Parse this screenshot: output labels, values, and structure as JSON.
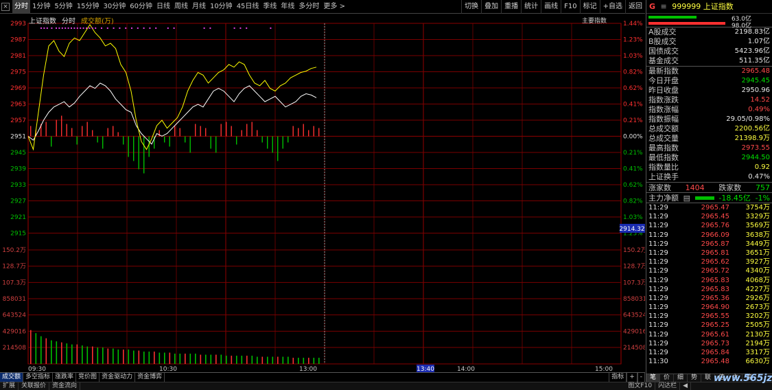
{
  "toolbar": {
    "close_label": "×",
    "periods": [
      "分时",
      "1分钟",
      "5分钟",
      "15分钟",
      "30分钟",
      "60分钟",
      "日线",
      "周线",
      "月线",
      "10分钟",
      "45日线",
      "季线",
      "年线",
      "多分时",
      "更多 >"
    ],
    "active_period": 0,
    "tools": [
      "切换",
      "叠加",
      "重播",
      "统计",
      "画线",
      "F10",
      "标记",
      "+自选",
      "返回"
    ]
  },
  "chart_header": {
    "title": "上证指数",
    "mode": "分时",
    "volume_label": "成交额(万)",
    "indicator_button": "主要指数"
  },
  "price_axis": {
    "left_labels": [
      "2993",
      "2987",
      "2981",
      "2975",
      "2969",
      "2963",
      "2957",
      "2951",
      "2945",
      "2939",
      "2933",
      "2927",
      "2921",
      "2915"
    ],
    "right_labels": [
      "1.44%",
      "1.23%",
      "1.03%",
      "0.82%",
      "0.62%",
      "0.41%",
      "0.21%",
      "0.00%",
      "0.21%",
      "0.41%",
      "0.62%",
      "0.82%",
      "1.03%",
      "1.23%"
    ],
    "prev_close_index": 7,
    "cursor_value": "2914.32"
  },
  "volume_axis": {
    "labels": [
      "150.2万",
      "128.7万",
      "107.3万",
      "858031",
      "643524",
      "429016",
      "214508"
    ]
  },
  "time_axis": {
    "labels": [
      "09:30",
      "10:30",
      "13:00",
      "13:40",
      "14:00",
      "15:00"
    ],
    "cursor_time": "13:40"
  },
  "bottom_tabs": {
    "tabs": [
      "成交额",
      "多空指标",
      "涨跌率",
      "竞价图",
      "资金驱动力",
      "资金博弈"
    ],
    "active": 0,
    "right": [
      "指标",
      "+",
      "-"
    ]
  },
  "status_bar": {
    "left": [
      "扩展",
      "关联报价",
      "资金流向"
    ],
    "right": [
      "图文F10",
      "闪达栏",
      "◀"
    ]
  },
  "colors": {
    "index_line": "#ffffff",
    "avg_line": "#ffff00",
    "grid": "#7a0000",
    "up": "#ff3030",
    "down": "#00c000"
  },
  "chart_data": {
    "type": "line",
    "prev_close": 2950.96,
    "ylim": [
      2912.5,
      2993.5
    ],
    "series": [
      {
        "values": [
          2950.96,
          2949.5,
          2953,
          2957,
          2960,
          2962,
          2963,
          2964,
          2962,
          2963.5,
          2966,
          2968,
          2970,
          2969,
          2971,
          2970,
          2968,
          2965,
          2963,
          2961,
          2960,
          2955,
          2952,
          2950,
          2948,
          2952,
          2951,
          2952,
          2954,
          2956,
          2958,
          2960,
          2962,
          2963,
          2962,
          2965,
          2968,
          2969,
          2968,
          2966,
          2964,
          2967,
          2969,
          2970,
          2968,
          2966,
          2964,
          2965,
          2966,
          2964,
          2962,
          2963,
          2964,
          2966,
          2967,
          2966.5,
          2965.5
        ]
      },
      {
        "values": [
          2950.96,
          2946,
          2960,
          2974,
          2985,
          2987,
          2983,
          2981,
          2986,
          2988,
          2987,
          2990,
          2993,
          2990,
          2988,
          2985,
          2986,
          2984,
          2978,
          2975,
          2968,
          2957,
          2949,
          2946,
          2950,
          2955,
          2957,
          2954,
          2956,
          2958,
          2962,
          2968,
          2972,
          2975,
          2974,
          2971,
          2973,
          2975,
          2976,
          2978,
          2977,
          2979,
          2978,
          2974,
          2971,
          2970,
          2972,
          2969,
          2968,
          2970,
          2971,
          2973,
          2974,
          2975,
          2975.5,
          2976.5,
          2977
        ]
      }
    ],
    "volume_bars": [
      0.33,
      0.3,
      0.27,
      0.25,
      0.23,
      0.22,
      0.21,
      0.2,
      0.19,
      0.19,
      0.18,
      0.17,
      0.17,
      0.16,
      0.16,
      0.15,
      0.15,
      0.14,
      0.14,
      0.14,
      0.13,
      0.13,
      0.12,
      0.12,
      0.12,
      0.11,
      0.11,
      0.11,
      0.1,
      0.1,
      0.1,
      0.1,
      0.1,
      0.09,
      0.09,
      0.09,
      0.09,
      0.09,
      0.08,
      0.08,
      0.08,
      0.08,
      0.08,
      0.08,
      0.07,
      0.07,
      0.07,
      0.07,
      0.07,
      0.07,
      0.07,
      0.06,
      0.06,
      0.06,
      0.06,
      0.06,
      0.06
    ],
    "breadth_bars": [
      0.5,
      0.3,
      0.6,
      0.7,
      -0.5,
      0.8,
      1.0,
      0.6,
      0.4,
      -0.4,
      0.5,
      0.7,
      0.3,
      -0.3,
      -0.6,
      0.4,
      0.5,
      0.2,
      -0.4,
      -1.0,
      -1.2,
      -1.6,
      -1.8,
      -1.0,
      -0.6,
      0.3,
      -0.3,
      -0.5,
      0.5,
      0.4,
      -0.3,
      -0.8,
      0.6,
      0.5,
      0.4,
      -0.6,
      -0.8,
      0.6,
      0.7,
      0.5,
      -0.4,
      0.3,
      0.6,
      0.7,
      0.3,
      -0.3,
      -0.6,
      -0.8,
      -1.2,
      -0.6,
      -0.3,
      0.5,
      0.4,
      0.6,
      0.3,
      0.5,
      0.4
    ]
  },
  "right_panel": {
    "title_letter": "G",
    "menu_icon": "≡",
    "code": "999999",
    "name": "上证指数",
    "bar_top_value": "63.0亿",
    "bar_bottom_value": "98.0亿",
    "stats1": [
      {
        "label": "A股成交",
        "value": "2198.83亿",
        "color": "white"
      },
      {
        "label": "B股成交",
        "value": "1.07亿",
        "color": "white"
      },
      {
        "label": "国债成交",
        "value": "5423.96亿",
        "color": "white"
      },
      {
        "label": "基金成交",
        "value": "511.35亿",
        "color": "white"
      }
    ],
    "stats2": [
      {
        "label": "最新指数",
        "value": "2965.48",
        "color": "red"
      },
      {
        "label": "今日开盘",
        "value": "2945.45",
        "color": "green"
      },
      {
        "label": "昨日收盘",
        "value": "2950.96",
        "color": "white"
      },
      {
        "label": "指数涨跌",
        "value": "14.52",
        "color": "red"
      },
      {
        "label": "指数涨幅",
        "value": "0.49%",
        "color": "red"
      },
      {
        "label": "指数振幅",
        "value": "29.05/0.98%",
        "color": "white"
      },
      {
        "label": "总成交额",
        "value": "2200.56亿",
        "color": "yellow"
      },
      {
        "label": "总成交量",
        "value": "21398.9万",
        "color": "yellow"
      },
      {
        "label": "最高指数",
        "value": "2973.55",
        "color": "red"
      },
      {
        "label": "最低指数",
        "value": "2944.50",
        "color": "green"
      },
      {
        "label": "指数量比",
        "value": "0.92",
        "color": "yellow"
      },
      {
        "label": "上证换手",
        "value": "0.47%",
        "color": "white"
      }
    ],
    "breadth": {
      "up_label": "涨家数",
      "up": "1404",
      "down_label": "跌家数",
      "down": "757"
    },
    "main_flow": {
      "label": "主力净额",
      "icon": "▤",
      "value": "-18.45亿",
      "pct": "-1%"
    },
    "ticks": [
      {
        "t": "11:29",
        "p": "2965.47",
        "v": "3754万"
      },
      {
        "t": "11:29",
        "p": "2965.45",
        "v": "3329万"
      },
      {
        "t": "11:29",
        "p": "2965.76",
        "v": "3569万"
      },
      {
        "t": "11:29",
        "p": "2966.09",
        "v": "3638万"
      },
      {
        "t": "11:29",
        "p": "2965.87",
        "v": "3449万"
      },
      {
        "t": "11:29",
        "p": "2965.81",
        "v": "3651万"
      },
      {
        "t": "11:29",
        "p": "2965.62",
        "v": "3927万"
      },
      {
        "t": "11:29",
        "p": "2965.72",
        "v": "4340万"
      },
      {
        "t": "11:29",
        "p": "2965.83",
        "v": "4068万"
      },
      {
        "t": "11:29",
        "p": "2965.83",
        "v": "4227万"
      },
      {
        "t": "11:29",
        "p": "2965.36",
        "v": "2926万"
      },
      {
        "t": "11:29",
        "p": "2964.90",
        "v": "2673万"
      },
      {
        "t": "11:29",
        "p": "2965.55",
        "v": "3202万"
      },
      {
        "t": "11:29",
        "p": "2965.25",
        "v": "2505万"
      },
      {
        "t": "11:29",
        "p": "2965.61",
        "v": "2130万"
      },
      {
        "t": "11:29",
        "p": "2965.73",
        "v": "2194万"
      },
      {
        "t": "11:29",
        "p": "2965.84",
        "v": "3317万"
      },
      {
        "t": "11:30",
        "p": "2965.48",
        "v": "6630万"
      }
    ],
    "tabs": [
      "笔",
      "价",
      "细",
      "势",
      "联",
      "值",
      "主",
      "筹"
    ],
    "active_tab": 0
  },
  "watermark": "www.565jz.com"
}
